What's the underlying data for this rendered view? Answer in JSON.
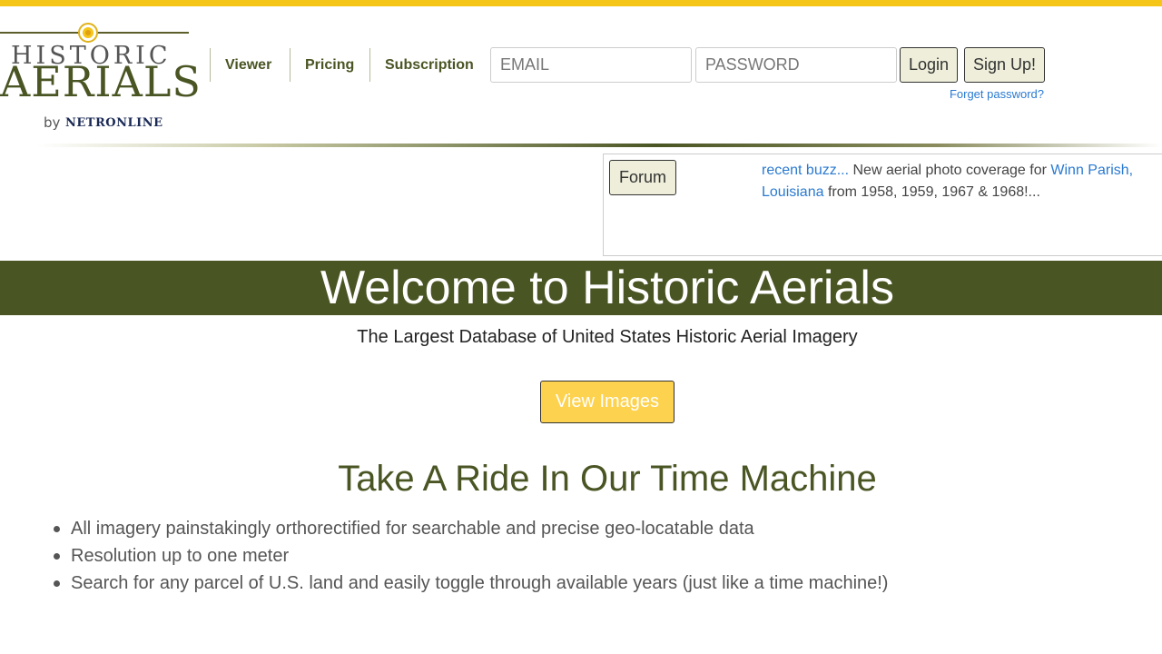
{
  "logo": {
    "line1": "HISTORIC",
    "line2": "AERIALS",
    "by": "by",
    "company": "NETRONLINE"
  },
  "nav": {
    "viewer": "Viewer",
    "pricing": "Pricing",
    "subscription": "Subscription"
  },
  "auth": {
    "email_placeholder": "EMAIL",
    "password_placeholder": "PASSWORD",
    "login": "Login",
    "signup": "Sign Up!",
    "forgot": "Forget password?"
  },
  "forum": {
    "button": "Forum",
    "buzz_link": "recent buzz...",
    "buzz_text1": " New aerial photo coverage for ",
    "buzz_place": "Winn Parish, Louisiana",
    "buzz_text2": " from 1958, 1959, 1967 & 1968!..."
  },
  "hero": {
    "title": "Welcome to Historic Aerials",
    "subtitle": "The Largest Database of United States Historic Aerial Imagery",
    "cta": "View Images"
  },
  "section": {
    "title": "Take A Ride In Our Time Machine",
    "features": [
      "All imagery painstakingly orthorectified for searchable and precise geo-locatable data",
      "Resolution up to one meter",
      "Search for any parcel of U.S. land and easily toggle through available years (just like a time machine!)"
    ]
  },
  "colors": {
    "accent_yellow": "#f5c518",
    "brand_green": "#4a5524",
    "link_blue": "#2a7ad1",
    "cta_yellow": "#fdd24e"
  }
}
